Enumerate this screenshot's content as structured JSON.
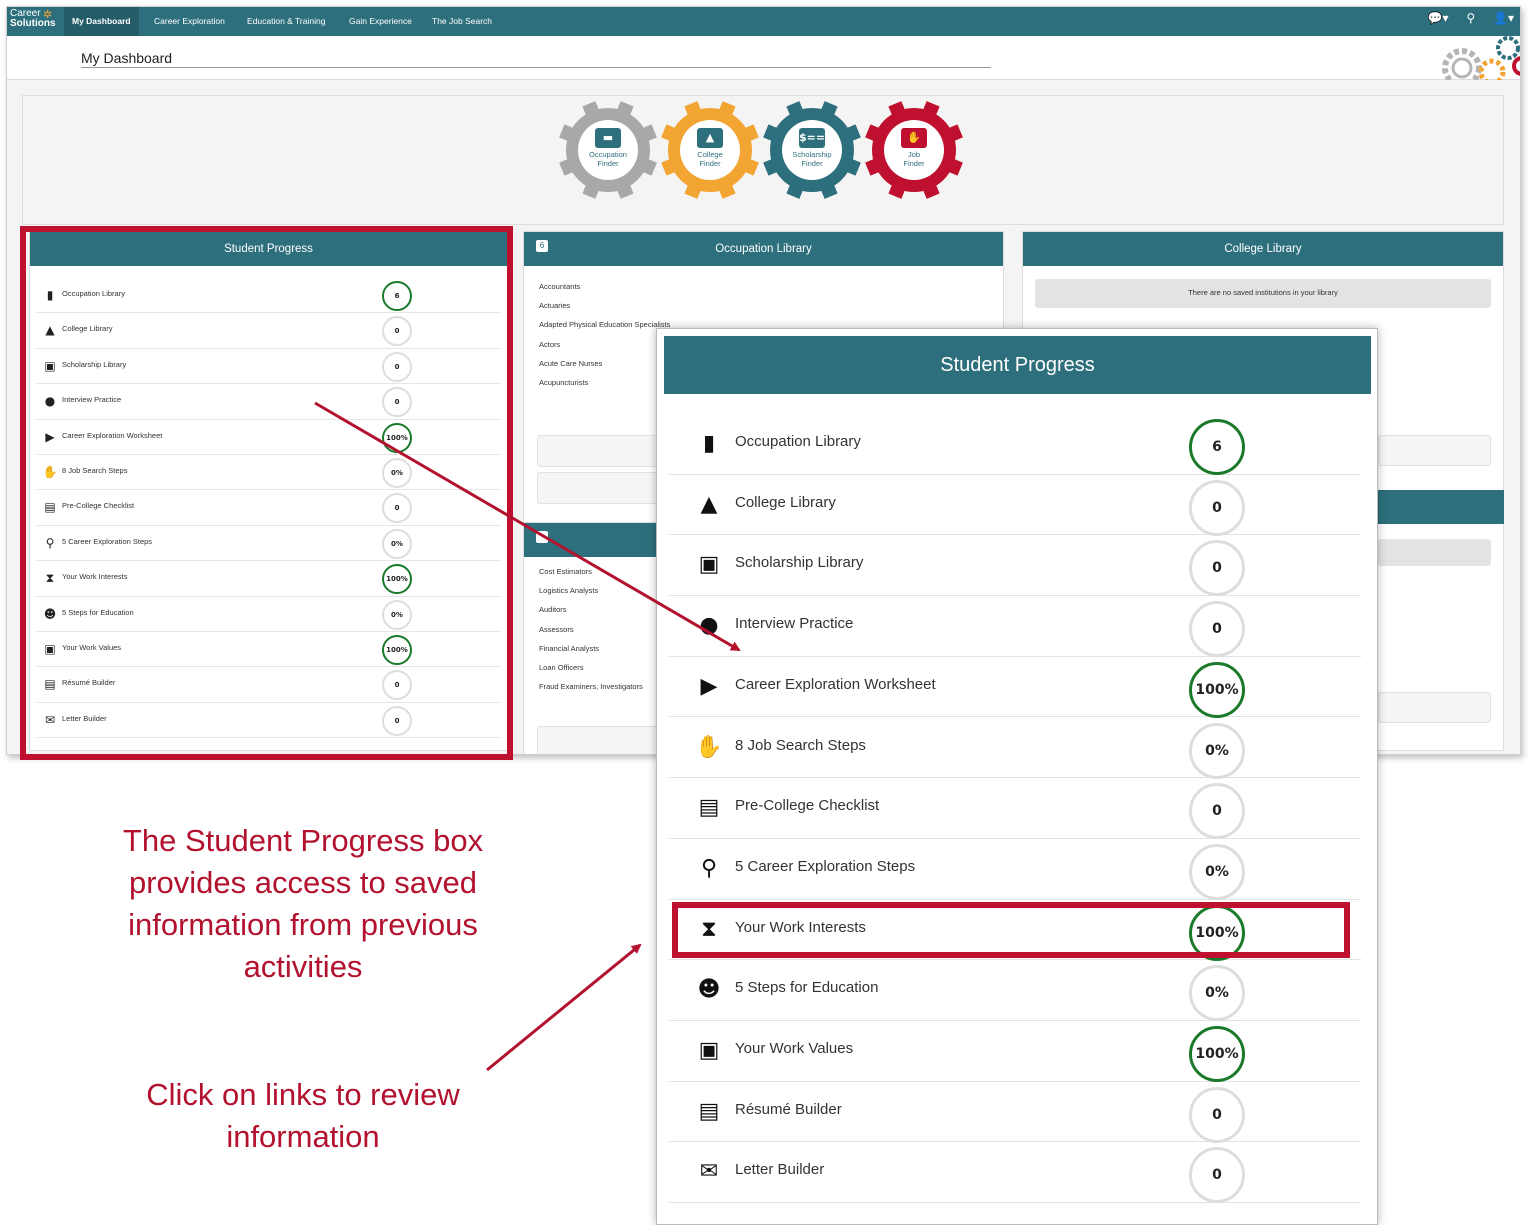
{
  "nav": {
    "logo_line1": "Career",
    "logo_line2": "Solutions",
    "items": [
      {
        "label": "My Dashboard",
        "active": true
      },
      {
        "label": "Career Exploration"
      },
      {
        "label": "Education & Training"
      },
      {
        "label": "Gain Experience"
      },
      {
        "label": "The Job Search"
      }
    ],
    "icons": [
      "chat-icon",
      "search-icon",
      "user-icon"
    ]
  },
  "page": {
    "title": "My Dashboard"
  },
  "finders": [
    {
      "line1": "Occupation",
      "line2": "Finder",
      "color": "#a8a8a8",
      "icon": "briefcase-icon",
      "glyph": "▬"
    },
    {
      "line1": "College",
      "line2": "Finder",
      "color": "#f2a533",
      "icon": "graduation-cap-icon",
      "glyph": "▲"
    },
    {
      "line1": "Scholarship",
      "line2": "Finder",
      "color": "#2d6f7c",
      "icon": "money-icon",
      "glyph": "$=="
    },
    {
      "line1": "Job",
      "line2": "Finder",
      "color": "#c0102f",
      "icon": "handshake-icon",
      "glyph": "✋"
    }
  ],
  "student_progress": {
    "title": "Student Progress",
    "items": [
      {
        "label": "Occupation Library",
        "value": "6",
        "done": true,
        "icon": "briefcase-icon",
        "glyph": "▮"
      },
      {
        "label": "College Library",
        "value": "0",
        "done": false,
        "icon": "graduation-cap-icon",
        "glyph": "▲"
      },
      {
        "label": "Scholarship Library",
        "value": "0",
        "done": false,
        "icon": "money-icon",
        "glyph": "▣"
      },
      {
        "label": "Interview Practice",
        "value": "0",
        "done": false,
        "icon": "comments-icon",
        "glyph": "●"
      },
      {
        "label": "Career Exploration Worksheet",
        "value": "100%",
        "done": true,
        "icon": "play-circle-icon",
        "glyph": "▶"
      },
      {
        "label": "8 Job Search Steps",
        "value": "0%",
        "done": false,
        "icon": "handshake-icon",
        "glyph": "✋"
      },
      {
        "label": "Pre-College Checklist",
        "value": "0",
        "done": false,
        "icon": "clipboard-icon",
        "glyph": "▤"
      },
      {
        "label": "5 Career Exploration Steps",
        "value": "0%",
        "done": false,
        "icon": "search-icon",
        "glyph": "⚲"
      },
      {
        "label": "Your Work Interests",
        "value": "100%",
        "done": true,
        "icon": "hourglass-icon",
        "glyph": "⧗"
      },
      {
        "label": "5 Steps for Education",
        "value": "0%",
        "done": false,
        "icon": "users-icon",
        "glyph": "☻"
      },
      {
        "label": "Your Work Values",
        "value": "100%",
        "done": true,
        "icon": "id-badge-icon",
        "glyph": "▣"
      },
      {
        "label": "Résumé Builder",
        "value": "0",
        "done": false,
        "icon": "file-icon",
        "glyph": "▤"
      },
      {
        "label": "Letter Builder",
        "value": "0",
        "done": false,
        "icon": "envelope-icon",
        "glyph": "✉"
      }
    ]
  },
  "occupation_library": {
    "title": "Occupation Library",
    "count": "6",
    "items": [
      "Accountants",
      "Actuaries",
      "Adapted Physical Education Specialists",
      "Actors",
      "Acute Care Nurses",
      "Acupuncturists"
    ]
  },
  "second_panel": {
    "items": [
      "Cost Estimators",
      "Logistics Analysts",
      "Auditors",
      "Assessors",
      "Financial Analysts",
      "Loan Officers",
      "Fraud Examiners, Investigators"
    ]
  },
  "college_library": {
    "title": "College Library",
    "empty_message": "There are no saved institutions in your library"
  },
  "annotations": {
    "caption1": "The Student Progress box provides access to saved information from previous activities",
    "caption2": "Click on links to review information",
    "highlight_color": "#c0102f"
  }
}
